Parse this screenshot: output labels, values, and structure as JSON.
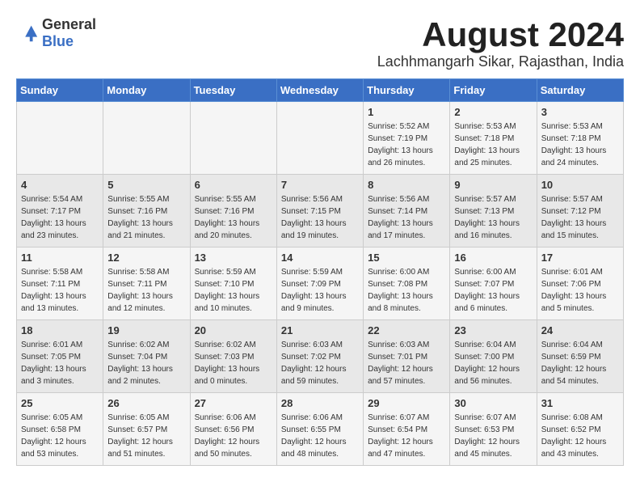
{
  "header": {
    "logo_general": "General",
    "logo_blue": "Blue",
    "month_title": "August 2024",
    "location": "Lachhmangarh Sikar, Rajasthan, India"
  },
  "weekdays": [
    "Sunday",
    "Monday",
    "Tuesday",
    "Wednesday",
    "Thursday",
    "Friday",
    "Saturday"
  ],
  "weeks": [
    [
      {
        "day": "",
        "sunrise": "",
        "sunset": "",
        "daylight": ""
      },
      {
        "day": "",
        "sunrise": "",
        "sunset": "",
        "daylight": ""
      },
      {
        "day": "",
        "sunrise": "",
        "sunset": "",
        "daylight": ""
      },
      {
        "day": "",
        "sunrise": "",
        "sunset": "",
        "daylight": ""
      },
      {
        "day": "1",
        "sunrise": "Sunrise: 5:52 AM",
        "sunset": "Sunset: 7:19 PM",
        "daylight": "Daylight: 13 hours and 26 minutes."
      },
      {
        "day": "2",
        "sunrise": "Sunrise: 5:53 AM",
        "sunset": "Sunset: 7:18 PM",
        "daylight": "Daylight: 13 hours and 25 minutes."
      },
      {
        "day": "3",
        "sunrise": "Sunrise: 5:53 AM",
        "sunset": "Sunset: 7:18 PM",
        "daylight": "Daylight: 13 hours and 24 minutes."
      }
    ],
    [
      {
        "day": "4",
        "sunrise": "Sunrise: 5:54 AM",
        "sunset": "Sunset: 7:17 PM",
        "daylight": "Daylight: 13 hours and 23 minutes."
      },
      {
        "day": "5",
        "sunrise": "Sunrise: 5:55 AM",
        "sunset": "Sunset: 7:16 PM",
        "daylight": "Daylight: 13 hours and 21 minutes."
      },
      {
        "day": "6",
        "sunrise": "Sunrise: 5:55 AM",
        "sunset": "Sunset: 7:16 PM",
        "daylight": "Daylight: 13 hours and 20 minutes."
      },
      {
        "day": "7",
        "sunrise": "Sunrise: 5:56 AM",
        "sunset": "Sunset: 7:15 PM",
        "daylight": "Daylight: 13 hours and 19 minutes."
      },
      {
        "day": "8",
        "sunrise": "Sunrise: 5:56 AM",
        "sunset": "Sunset: 7:14 PM",
        "daylight": "Daylight: 13 hours and 17 minutes."
      },
      {
        "day": "9",
        "sunrise": "Sunrise: 5:57 AM",
        "sunset": "Sunset: 7:13 PM",
        "daylight": "Daylight: 13 hours and 16 minutes."
      },
      {
        "day": "10",
        "sunrise": "Sunrise: 5:57 AM",
        "sunset": "Sunset: 7:12 PM",
        "daylight": "Daylight: 13 hours and 15 minutes."
      }
    ],
    [
      {
        "day": "11",
        "sunrise": "Sunrise: 5:58 AM",
        "sunset": "Sunset: 7:11 PM",
        "daylight": "Daylight: 13 hours and 13 minutes."
      },
      {
        "day": "12",
        "sunrise": "Sunrise: 5:58 AM",
        "sunset": "Sunset: 7:11 PM",
        "daylight": "Daylight: 13 hours and 12 minutes."
      },
      {
        "day": "13",
        "sunrise": "Sunrise: 5:59 AM",
        "sunset": "Sunset: 7:10 PM",
        "daylight": "Daylight: 13 hours and 10 minutes."
      },
      {
        "day": "14",
        "sunrise": "Sunrise: 5:59 AM",
        "sunset": "Sunset: 7:09 PM",
        "daylight": "Daylight: 13 hours and 9 minutes."
      },
      {
        "day": "15",
        "sunrise": "Sunrise: 6:00 AM",
        "sunset": "Sunset: 7:08 PM",
        "daylight": "Daylight: 13 hours and 8 minutes."
      },
      {
        "day": "16",
        "sunrise": "Sunrise: 6:00 AM",
        "sunset": "Sunset: 7:07 PM",
        "daylight": "Daylight: 13 hours and 6 minutes."
      },
      {
        "day": "17",
        "sunrise": "Sunrise: 6:01 AM",
        "sunset": "Sunset: 7:06 PM",
        "daylight": "Daylight: 13 hours and 5 minutes."
      }
    ],
    [
      {
        "day": "18",
        "sunrise": "Sunrise: 6:01 AM",
        "sunset": "Sunset: 7:05 PM",
        "daylight": "Daylight: 13 hours and 3 minutes."
      },
      {
        "day": "19",
        "sunrise": "Sunrise: 6:02 AM",
        "sunset": "Sunset: 7:04 PM",
        "daylight": "Daylight: 13 hours and 2 minutes."
      },
      {
        "day": "20",
        "sunrise": "Sunrise: 6:02 AM",
        "sunset": "Sunset: 7:03 PM",
        "daylight": "Daylight: 13 hours and 0 minutes."
      },
      {
        "day": "21",
        "sunrise": "Sunrise: 6:03 AM",
        "sunset": "Sunset: 7:02 PM",
        "daylight": "Daylight: 12 hours and 59 minutes."
      },
      {
        "day": "22",
        "sunrise": "Sunrise: 6:03 AM",
        "sunset": "Sunset: 7:01 PM",
        "daylight": "Daylight: 12 hours and 57 minutes."
      },
      {
        "day": "23",
        "sunrise": "Sunrise: 6:04 AM",
        "sunset": "Sunset: 7:00 PM",
        "daylight": "Daylight: 12 hours and 56 minutes."
      },
      {
        "day": "24",
        "sunrise": "Sunrise: 6:04 AM",
        "sunset": "Sunset: 6:59 PM",
        "daylight": "Daylight: 12 hours and 54 minutes."
      }
    ],
    [
      {
        "day": "25",
        "sunrise": "Sunrise: 6:05 AM",
        "sunset": "Sunset: 6:58 PM",
        "daylight": "Daylight: 12 hours and 53 minutes."
      },
      {
        "day": "26",
        "sunrise": "Sunrise: 6:05 AM",
        "sunset": "Sunset: 6:57 PM",
        "daylight": "Daylight: 12 hours and 51 minutes."
      },
      {
        "day": "27",
        "sunrise": "Sunrise: 6:06 AM",
        "sunset": "Sunset: 6:56 PM",
        "daylight": "Daylight: 12 hours and 50 minutes."
      },
      {
        "day": "28",
        "sunrise": "Sunrise: 6:06 AM",
        "sunset": "Sunset: 6:55 PM",
        "daylight": "Daylight: 12 hours and 48 minutes."
      },
      {
        "day": "29",
        "sunrise": "Sunrise: 6:07 AM",
        "sunset": "Sunset: 6:54 PM",
        "daylight": "Daylight: 12 hours and 47 minutes."
      },
      {
        "day": "30",
        "sunrise": "Sunrise: 6:07 AM",
        "sunset": "Sunset: 6:53 PM",
        "daylight": "Daylight: 12 hours and 45 minutes."
      },
      {
        "day": "31",
        "sunrise": "Sunrise: 6:08 AM",
        "sunset": "Sunset: 6:52 PM",
        "daylight": "Daylight: 12 hours and 43 minutes."
      }
    ]
  ]
}
